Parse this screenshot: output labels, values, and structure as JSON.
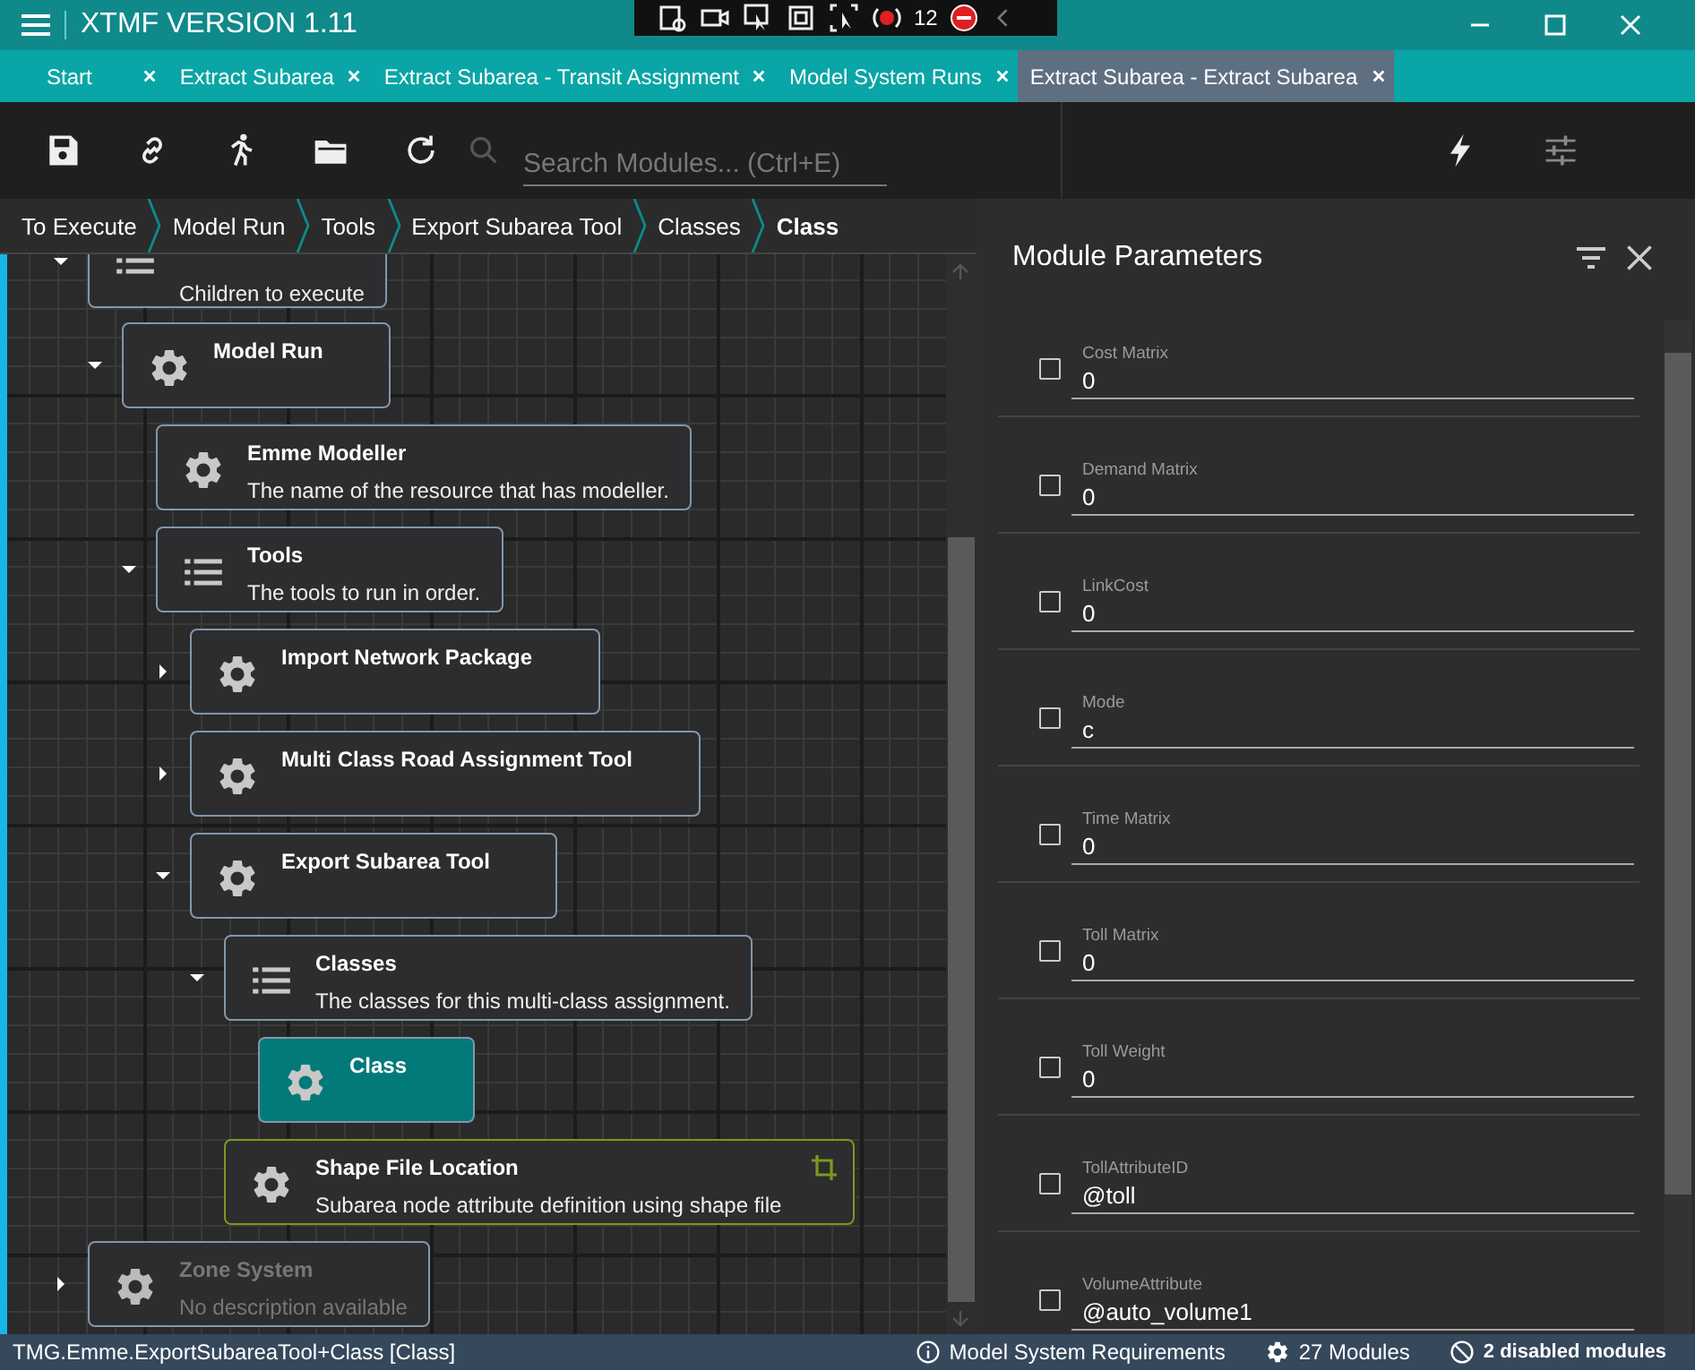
{
  "window": {
    "title": "XTMF VERSION 1.11"
  },
  "recorder_toolbar": {
    "count": "12"
  },
  "tabs": [
    {
      "label": "Start",
      "selected": false
    },
    {
      "label": "Extract Subarea",
      "selected": false
    },
    {
      "label": "Extract Subarea - Transit Assignment",
      "selected": false
    },
    {
      "label": "Model System Runs",
      "selected": false
    },
    {
      "label": "Extract Subarea - Extract Subarea",
      "selected": true
    }
  ],
  "toolbar": {
    "search": {
      "placeholder": "Search Modules... (Ctrl+E)"
    }
  },
  "breadcrumb": [
    "To Execute",
    "Model Run",
    "Tools",
    "Export Subarea Tool",
    "Classes",
    "Class"
  ],
  "tree": [
    {
      "kind": "collection",
      "description": "Children to execute",
      "expanded": true,
      "children": [
        {
          "kind": "module",
          "title": "Model Run",
          "expanded": true,
          "children": [
            {
              "kind": "module",
              "title": "Emme Modeller",
              "description": "The name of the resource that has modeller."
            },
            {
              "kind": "collection",
              "title": "Tools",
              "description": "The tools to run in order.",
              "expanded": true,
              "children": [
                {
                  "kind": "module",
                  "title": "Import Network Package",
                  "expanded": false
                },
                {
                  "kind": "module",
                  "title": "Multi Class Road Assignment Tool",
                  "expanded": false
                },
                {
                  "kind": "module",
                  "title": "Export Subarea Tool",
                  "expanded": true,
                  "children": [
                    {
                      "kind": "collection",
                      "title": "Classes",
                      "description": "The classes for this multi-class assignment.",
                      "expanded": true,
                      "children": [
                        {
                          "kind": "module",
                          "title": "Class",
                          "selected": true
                        }
                      ]
                    },
                    {
                      "kind": "module",
                      "title": "Shape File Location",
                      "description": "Subarea node attribute definition using shape file",
                      "color": "#7a9a1e",
                      "linked": true
                    }
                  ]
                }
              ]
            }
          ]
        }
      ]
    },
    {
      "kind": "module",
      "title": "Zone System",
      "description": "No description available",
      "expanded": false,
      "disabled": true
    }
  ],
  "parameters_panel": {
    "title": "Module Parameters",
    "parameters": [
      {
        "label": "Cost Matrix",
        "value": "0",
        "checked": false
      },
      {
        "label": "Demand Matrix",
        "value": "0",
        "checked": false
      },
      {
        "label": "LinkCost",
        "value": "0",
        "checked": false
      },
      {
        "label": "Mode",
        "value": "c",
        "checked": false
      },
      {
        "label": "Time Matrix",
        "value": "0",
        "checked": false
      },
      {
        "label": "Toll Matrix",
        "value": "0",
        "checked": false
      },
      {
        "label": "Toll Weight",
        "value": "0",
        "checked": false
      },
      {
        "label": "TollAttributeID",
        "value": "@toll",
        "checked": false
      },
      {
        "label": "VolumeAttribute",
        "value": "@auto_volume1",
        "checked": false
      }
    ]
  },
  "status_bar": {
    "path": "TMG.Emme.ExportSubareaTool+Class [Class]",
    "requirements": "Model System Requirements",
    "modules": "27 Modules",
    "disabled": "2 disabled modules"
  }
}
